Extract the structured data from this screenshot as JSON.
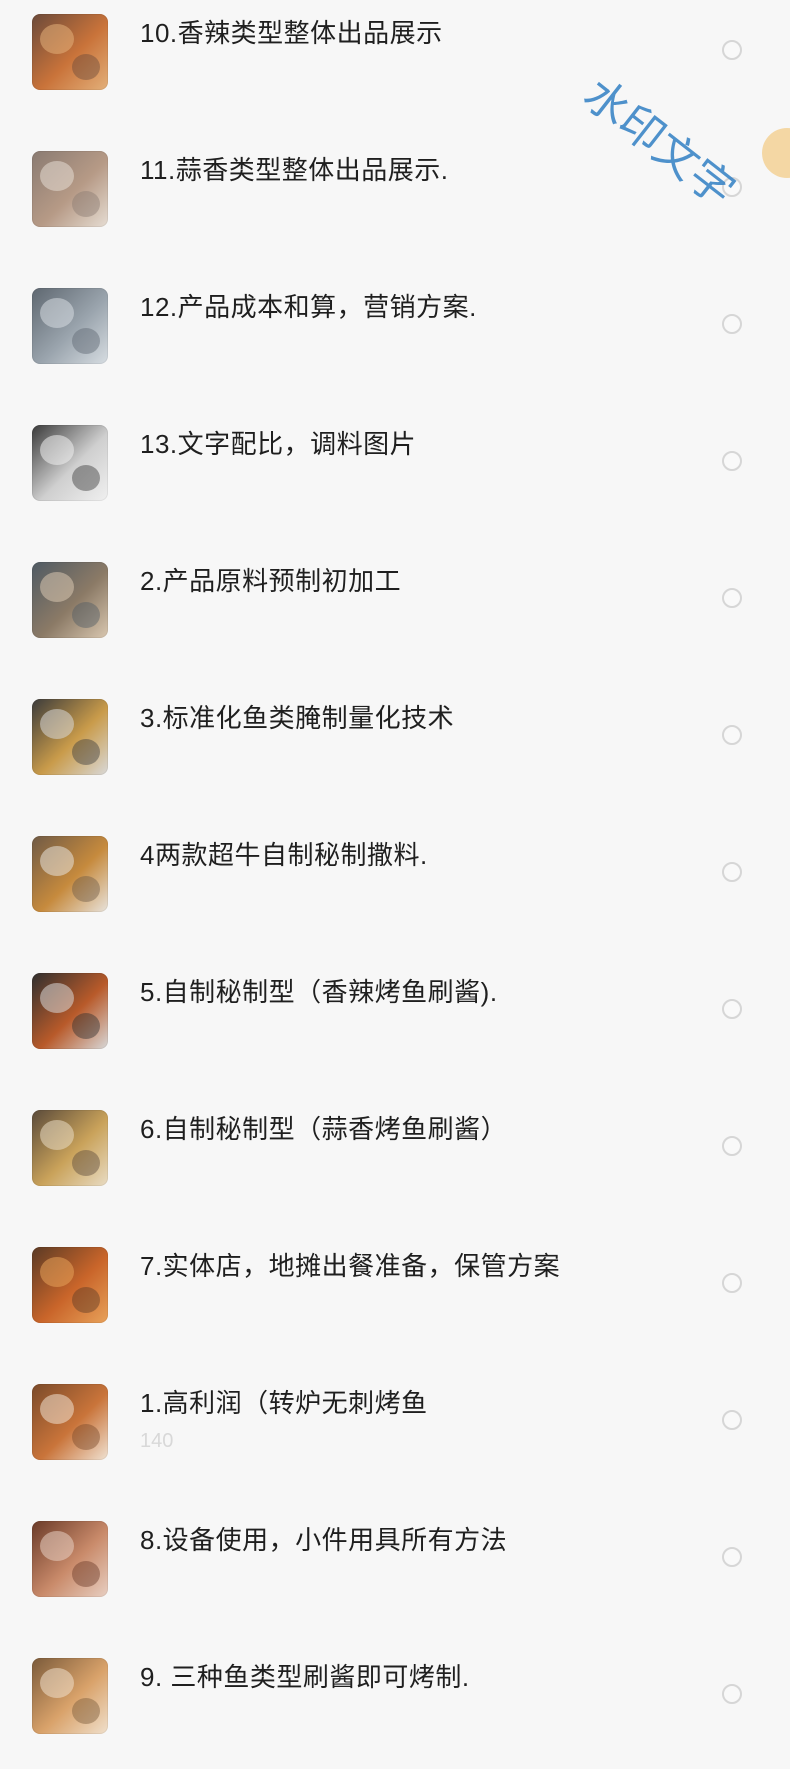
{
  "items": [
    {
      "title": "10.香辣类型整体出品展示",
      "subtitle": "",
      "thumb_colors": [
        "#6b4a3a",
        "#c9733a",
        "#e3b07a"
      ]
    },
    {
      "title": "11.蒜香类型整体出品展示.",
      "subtitle": "",
      "thumb_colors": [
        "#8a7b72",
        "#b69a86",
        "#e6ddd3"
      ]
    },
    {
      "title": "12.产品成本和算，营销方案.",
      "subtitle": "",
      "thumb_colors": [
        "#5e6770",
        "#9aa4ad",
        "#d7dde2"
      ]
    },
    {
      "title": "13.文字配比，调料图片",
      "subtitle": "",
      "thumb_colors": [
        "#3a3a3a",
        "#cfcfcf",
        "#f0f0f0"
      ]
    },
    {
      "title": "2.产品原料预制初加工",
      "subtitle": "",
      "thumb_colors": [
        "#4f5a63",
        "#8b7a66",
        "#d9c7b0"
      ]
    },
    {
      "title": "3.标准化鱼类腌制量化技术",
      "subtitle": "",
      "thumb_colors": [
        "#3b3b3b",
        "#c99b4a",
        "#d9d9d9"
      ]
    },
    {
      "title": "4两款超牛自制秘制撒料.",
      "subtitle": "",
      "thumb_colors": [
        "#6f5a46",
        "#c68a3d",
        "#e8e3dc"
      ]
    },
    {
      "title": "5.自制秘制型（香辣烤鱼刷酱).",
      "subtitle": "",
      "thumb_colors": [
        "#2f2f2f",
        "#b85a2a",
        "#d8d8d8"
      ]
    },
    {
      "title": "6.自制秘制型（蒜香烤鱼刷酱）",
      "subtitle": "",
      "thumb_colors": [
        "#5a4a3a",
        "#c9a25a",
        "#e9dcc4"
      ]
    },
    {
      "title": "7.实体店，地摊出餐准备，保管方案",
      "subtitle": "",
      "thumb_colors": [
        "#5a3a25",
        "#c9652a",
        "#e8a25a"
      ]
    },
    {
      "title": "1.高利润（转炉无刺烤鱼",
      "subtitle": "140",
      "thumb_colors": [
        "#7a4a2a",
        "#c9743a",
        "#f0e2d2"
      ]
    },
    {
      "title": "8.设备使用，小件用具所有方法",
      "subtitle": "",
      "thumb_colors": [
        "#6a3a28",
        "#c98a6a",
        "#e8cfc2"
      ]
    },
    {
      "title": "9. 三种鱼类型刷酱即可烤制.",
      "subtitle": "",
      "thumb_colors": [
        "#7a5a3a",
        "#d9a26a",
        "#f0e0cc"
      ]
    }
  ],
  "watermark": "水印文字"
}
